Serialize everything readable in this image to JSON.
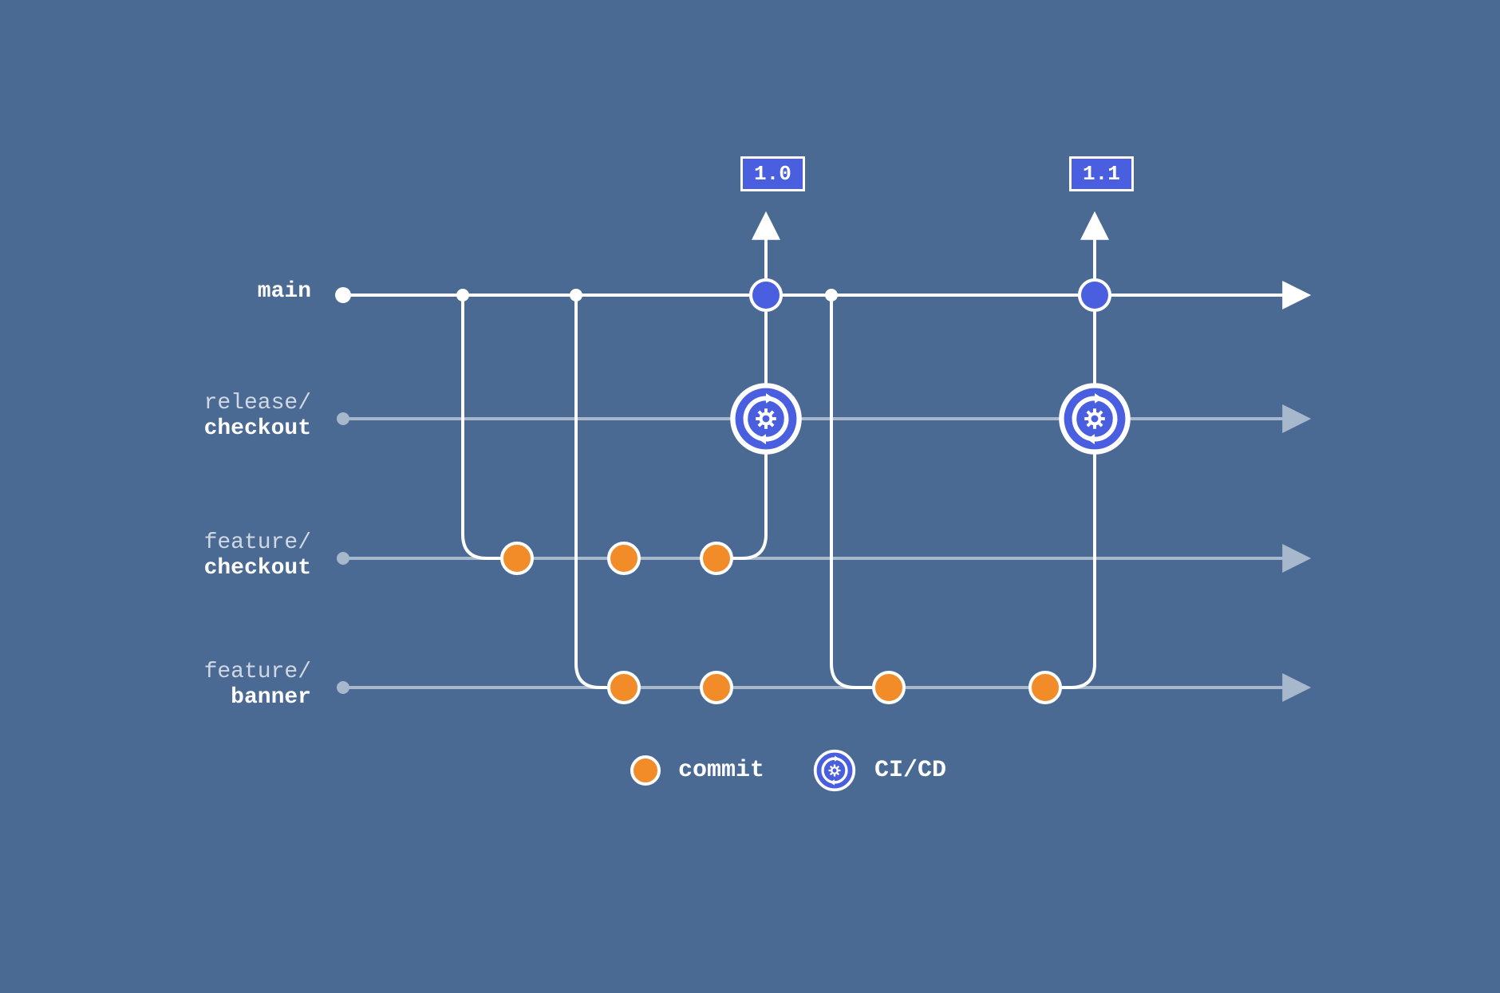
{
  "branches": {
    "main": {
      "label": "main"
    },
    "release": {
      "line1": "release/",
      "line2": "checkout"
    },
    "feature_checkout": {
      "line1": "feature/",
      "line2": "checkout"
    },
    "feature_banner": {
      "line1": "feature/",
      "line2": "banner"
    }
  },
  "tags": {
    "v10": "1.0",
    "v11": "1.1"
  },
  "legend": {
    "commit": "commit",
    "cicd": "CI/CD"
  },
  "colors": {
    "background": "#4a6a94",
    "white": "#ffffff",
    "faded": "#a8b8cc",
    "orange": "#f28c28",
    "blue": "#4a5fe0"
  },
  "layout": {
    "lane_y": {
      "main": 370,
      "release": 525,
      "feature_checkout": 700,
      "feature_banner": 862
    },
    "x": {
      "start": 430,
      "branch1": 580,
      "branch2": 722,
      "fc_commit1": 648,
      "fc_commit2": 782,
      "fc_commit3": 898,
      "tag10_merge": 960,
      "branch3": 1042,
      "fb_commit1": 782,
      "fb_commit2": 898,
      "fb_commit3": 1114,
      "fb_commit4": 1310,
      "tag11_merge": 1372,
      "arrow_end": 1640
    }
  }
}
